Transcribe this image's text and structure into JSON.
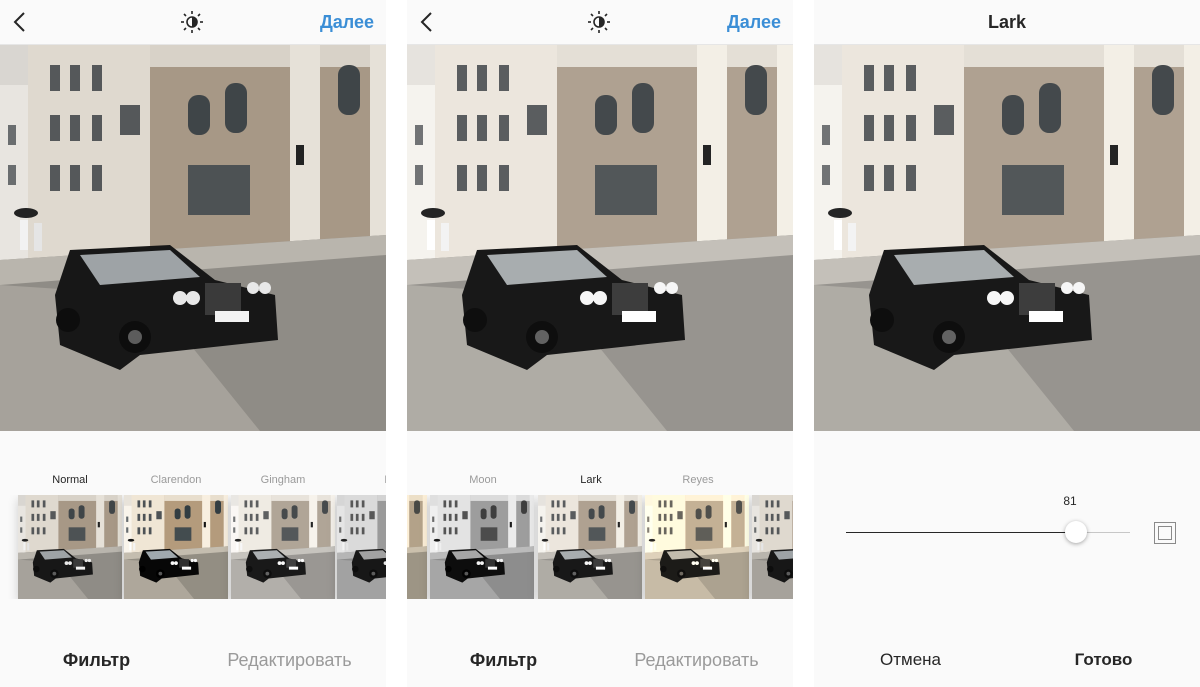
{
  "panel1": {
    "next_label": "Далее",
    "filters": [
      "Normal",
      "Clarendon",
      "Gingham",
      "M"
    ],
    "tabs": {
      "filter": "Фильтр",
      "edit": "Редактировать"
    }
  },
  "panel2": {
    "next_label": "Далее",
    "filters": [
      "Moon",
      "Lark",
      "Reyes",
      ""
    ],
    "tabs": {
      "filter": "Фильтр",
      "edit": "Редактировать"
    }
  },
  "panel3": {
    "title": "Lark",
    "slider_value": "81",
    "slider_fraction": 0.81,
    "cancel_label": "Отмена",
    "done_label": "Готово"
  },
  "colors": {
    "accent": "#3b8ed6",
    "text": "#262626",
    "muted": "#9a9a9a"
  }
}
